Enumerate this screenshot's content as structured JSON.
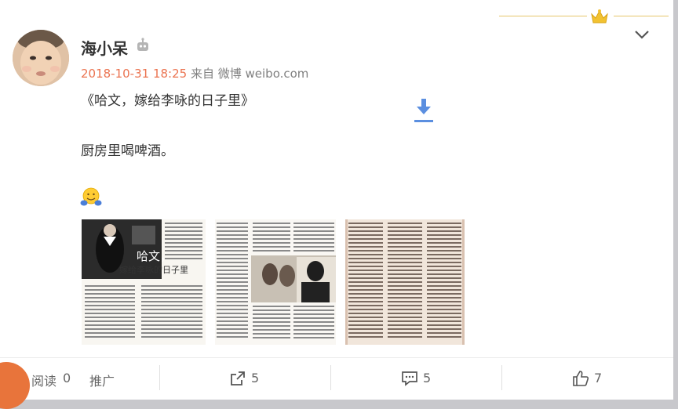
{
  "post": {
    "username": "海小呆",
    "timestamp": "2018-10-31 18:25",
    "source_prefix": "来自",
    "source": "微博 weibo.com",
    "line1": "《哈文，嫁给李咏的日子里》",
    "line2": "厨房里喝啤酒。",
    "magazine_title": "哈文，",
    "magazine_subtitle": "嫁给李咏的日子里"
  },
  "footer": {
    "read_label": "阅读",
    "read_count": "0",
    "promote_label": "推广",
    "share_count": "5",
    "comment_count": "5",
    "like_count": "7"
  },
  "colors": {
    "accent": "#eb7350",
    "download_blue": "#5b8fe0",
    "gold": "#e6c76b"
  }
}
